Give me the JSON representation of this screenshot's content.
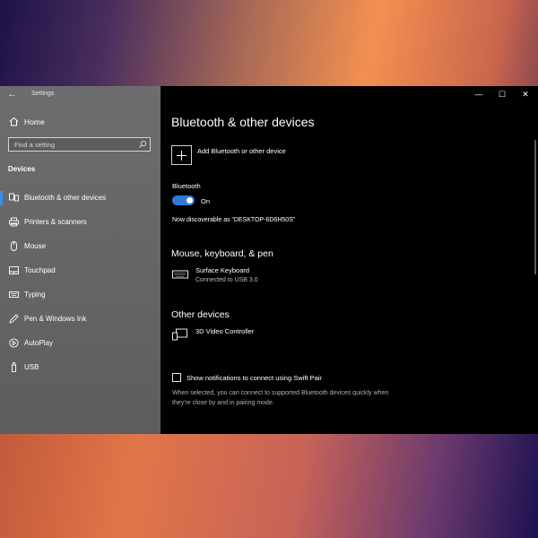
{
  "window": {
    "app_title": "Settings",
    "controls": {
      "minimize": "—",
      "maximize": "☐",
      "close": "✕"
    }
  },
  "sidebar": {
    "home_label": "Home",
    "search_placeholder": "Find a setting",
    "section_header": "Devices",
    "items": [
      {
        "label": "Bluetooth & other devices",
        "icon": "bluetooth-devices-icon",
        "selected": true
      },
      {
        "label": "Printers & scanners",
        "icon": "printer-icon"
      },
      {
        "label": "Mouse",
        "icon": "mouse-icon"
      },
      {
        "label": "Touchpad",
        "icon": "touchpad-icon"
      },
      {
        "label": "Typing",
        "icon": "keyboard-icon"
      },
      {
        "label": "Pen & Windows Ink",
        "icon": "pen-icon"
      },
      {
        "label": "AutoPlay",
        "icon": "autoplay-icon"
      },
      {
        "label": "USB",
        "icon": "usb-icon"
      }
    ]
  },
  "main": {
    "title": "Bluetooth & other devices",
    "add_device_label": "Add Bluetooth or other device",
    "bluetooth_label": "Bluetooth",
    "bluetooth_state": "On",
    "discoverable_text": "Now discoverable as “DESKTOP-6D6H50S”",
    "mouse_section": {
      "title": "Mouse, keyboard, & pen",
      "device_name": "Surface Keyboard",
      "device_status": "Connected to USB 3.0"
    },
    "other_section": {
      "title": "Other devices",
      "device_name": "3D Video Controller"
    },
    "swift_pair_label": "Show notifications to connect using Swift Pair",
    "swift_pair_help": "When selected, you can connect to supported Bluetooth devices quickly when they're close by and in pairing mode."
  },
  "colors": {
    "accent": "#2f78d4",
    "selection_bar": "#3b8ee8",
    "content_bg": "#000000",
    "sidebar_bg": "#666668"
  }
}
